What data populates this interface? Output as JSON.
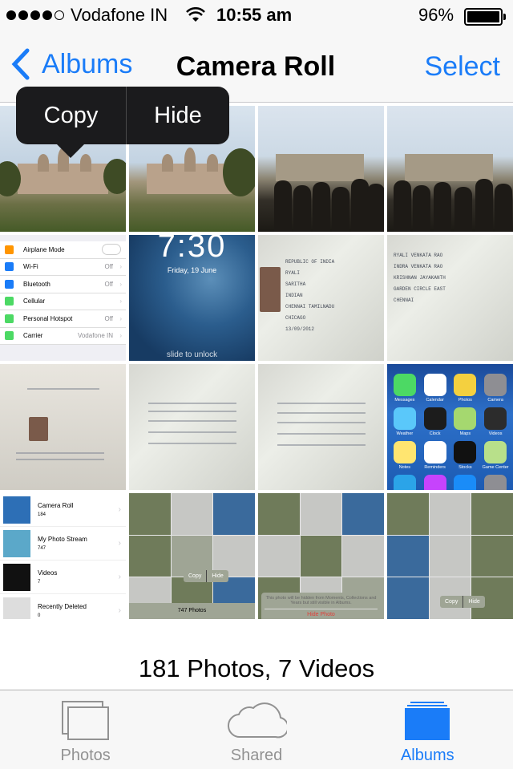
{
  "status_bar": {
    "carrier": "Vodafone IN",
    "time": "10:55 am",
    "battery": "96%",
    "signal_bars": 4,
    "signal_total": 5,
    "battery_level": 0.96
  },
  "nav": {
    "back_label": "Albums",
    "title": "Camera Roll",
    "select_label": "Select"
  },
  "popover": {
    "copy_label": "Copy",
    "hide_label": "Hide"
  },
  "thumbnails": {
    "settings": {
      "rows": [
        {
          "label": "Airplane Mode",
          "value": "",
          "color": "#ff9500"
        },
        {
          "label": "Wi-Fi",
          "value": "Off",
          "color": "#1a7cf8"
        },
        {
          "label": "Bluetooth",
          "value": "Off",
          "color": "#1a7cf8"
        },
        {
          "label": "Cellular",
          "value": "",
          "color": "#4cd964"
        },
        {
          "label": "Personal Hotspot",
          "value": "Off",
          "color": "#4cd964"
        },
        {
          "label": "Carrier",
          "value": "Vodafone IN",
          "color": "#4cd964"
        }
      ]
    },
    "lock": {
      "time": "7:30",
      "date": "Friday, 19 June",
      "slide": "slide to unlock"
    },
    "passport1": {
      "lines": [
        "REPUBLIC OF INDIA",
        "RYALI",
        "SARITHA",
        "INDIAN",
        "CHENNAI TAMILNADU",
        "CHICAGO",
        "13/09/2012"
      ]
    },
    "passport2": {
      "lines": [
        "RYALI VENKATA RAO",
        "INDRA VENKATA RAO",
        "KRISHNAN JAYAKANTH",
        "GARDEN CIRCLE EAST",
        "CHENNAI"
      ]
    },
    "home": {
      "apps": [
        {
          "label": "Messages",
          "color": "#4cd964"
        },
        {
          "label": "Calendar",
          "color": "#ffffff"
        },
        {
          "label": "Photos",
          "color": "#f4d03f"
        },
        {
          "label": "Camera",
          "color": "#8e8e93"
        },
        {
          "label": "Weather",
          "color": "#5ac8fa"
        },
        {
          "label": "Clock",
          "color": "#1c1c1c"
        },
        {
          "label": "Maps",
          "color": "#a5d86f"
        },
        {
          "label": "Videos",
          "color": "#2c2c2c"
        },
        {
          "label": "Notes",
          "color": "#ffe570"
        },
        {
          "label": "Reminders",
          "color": "#ffffff"
        },
        {
          "label": "Stocks",
          "color": "#111111"
        },
        {
          "label": "Game Center",
          "color": "#b8e08a"
        },
        {
          "label": "Passbook",
          "color": "#2ba4e8"
        },
        {
          "label": "iTunes Store",
          "color": "#c643fc"
        },
        {
          "label": "App Store",
          "color": "#1a8cf8"
        },
        {
          "label": "Settings",
          "color": "#8e8e93"
        }
      ]
    },
    "albums": {
      "rows": [
        {
          "name": "Camera Roll",
          "count": "184"
        },
        {
          "name": "My Photo Stream",
          "count": "747"
        },
        {
          "name": "Videos",
          "count": "7"
        },
        {
          "name": "Recently Deleted",
          "count": "0"
        }
      ]
    },
    "collage1": {
      "caption": "747 Photos",
      "copy": "Copy",
      "hide": "Hide"
    },
    "collage2": {
      "sheet_text": "This photo will be hidden from Moments, Collections and Years but still visible in Albums.",
      "sheet_button": "Hide Photo"
    },
    "collage3": {
      "copy": "Copy",
      "hide": "Hide"
    }
  },
  "summary": "181 Photos, 7 Videos",
  "tabs": [
    {
      "label": "Photos",
      "icon": "photos-icon",
      "active": false
    },
    {
      "label": "Shared",
      "icon": "cloud-icon",
      "active": false
    },
    {
      "label": "Albums",
      "icon": "albums-icon",
      "active": true
    }
  ],
  "colors": {
    "accent": "#1a7cf8",
    "inactive_tab": "#929292",
    "popover_bg": "#1b1b1d"
  }
}
